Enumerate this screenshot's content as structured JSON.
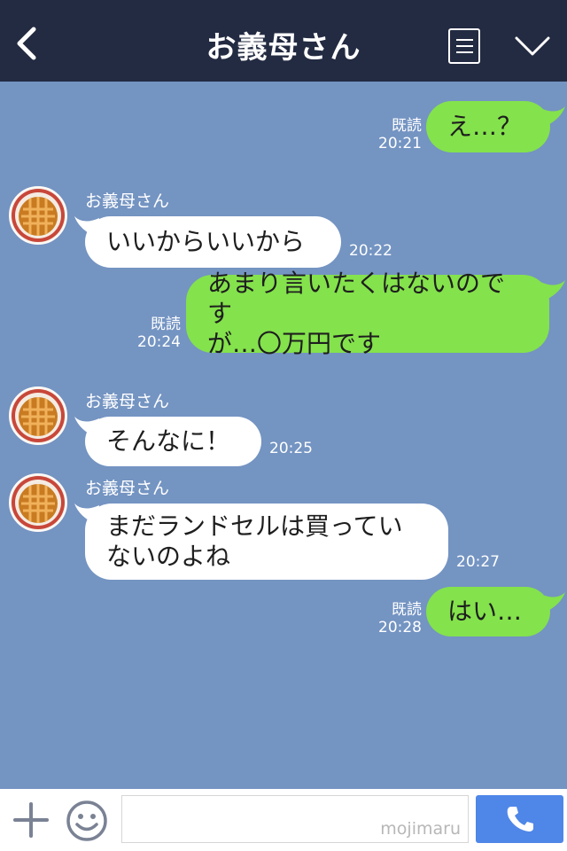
{
  "header": {
    "title": "お義母さん"
  },
  "messages": [
    {
      "dir": "out",
      "text": "え…？",
      "read": "既読",
      "time": "20:21"
    },
    {
      "dir": "in",
      "sender": "お義母さん",
      "text": "いいからいいから",
      "time": "20:22"
    },
    {
      "dir": "out",
      "text": "あまり言いたくはないのです\nが…〇万円です",
      "read": "既読",
      "time": "20:24"
    },
    {
      "dir": "in",
      "sender": "お義母さん",
      "text": "そんなに！",
      "time": "20:25"
    },
    {
      "dir": "in",
      "sender": "お義母さん",
      "text": "まだランドセルは買ってい\nないのよね",
      "time": "20:27"
    },
    {
      "dir": "out",
      "text": "はい…",
      "read": "既読",
      "time": "20:28"
    }
  ],
  "footer": {
    "input_value": "",
    "watermark": "mojimaru"
  },
  "colors": {
    "background": "#7494c2",
    "header": "#232b42",
    "outgoing_bubble": "#84e24c",
    "incoming_bubble": "#ffffff",
    "call_button": "#4f87e8"
  },
  "icons": [
    "back-chevron-icon",
    "note-menu-icon",
    "chevron-down-icon",
    "plus-icon",
    "smiley-icon",
    "phone-icon"
  ]
}
